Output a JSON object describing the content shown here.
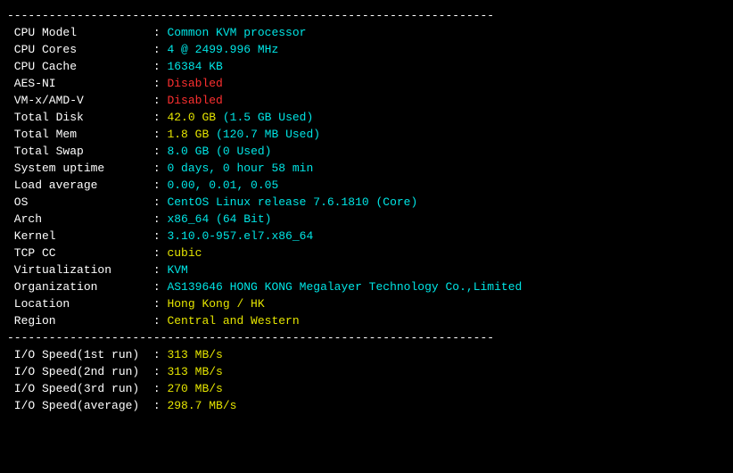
{
  "dividers": {
    "top": "----------------------------------------------------------------------",
    "mid": "----------------------------------------------------------------------"
  },
  "fields": [
    {
      "label": "CPU Model",
      "value": [
        {
          "t": "Common KVM processor",
          "c": "cyan"
        }
      ]
    },
    {
      "label": "CPU Cores",
      "value": [
        {
          "t": "4 @ 2499.996 MHz",
          "c": "cyan"
        }
      ]
    },
    {
      "label": "CPU Cache",
      "value": [
        {
          "t": "16384 KB",
          "c": "cyan"
        }
      ]
    },
    {
      "label": "AES-NI",
      "value": [
        {
          "t": "Disabled",
          "c": "red"
        }
      ]
    },
    {
      "label": "VM-x/AMD-V",
      "value": [
        {
          "t": "Disabled",
          "c": "red"
        }
      ]
    },
    {
      "label": "Total Disk",
      "value": [
        {
          "t": "42.0 GB",
          "c": "yellow"
        },
        {
          "t": " ",
          "c": "white"
        },
        {
          "t": "(1.5 GB Used)",
          "c": "cyan"
        }
      ]
    },
    {
      "label": "Total Mem",
      "value": [
        {
          "t": "1.8 GB",
          "c": "yellow"
        },
        {
          "t": " ",
          "c": "white"
        },
        {
          "t": "(120.7 MB Used)",
          "c": "cyan"
        }
      ]
    },
    {
      "label": "Total Swap",
      "value": [
        {
          "t": "8.0 GB",
          "c": "cyan"
        },
        {
          "t": " ",
          "c": "white"
        },
        {
          "t": "(0 Used)",
          "c": "cyan"
        }
      ]
    },
    {
      "label": "System uptime",
      "value": [
        {
          "t": "0 days, 0 hour 58 min",
          "c": "cyan"
        }
      ]
    },
    {
      "label": "Load average",
      "value": [
        {
          "t": "0.00, 0.01, 0.05",
          "c": "cyan"
        }
      ]
    },
    {
      "label": "OS",
      "value": [
        {
          "t": "CentOS Linux release 7.6.1810 (Core)",
          "c": "cyan"
        }
      ]
    },
    {
      "label": "Arch",
      "value": [
        {
          "t": "x86_64 (64 Bit)",
          "c": "cyan"
        }
      ]
    },
    {
      "label": "Kernel",
      "value": [
        {
          "t": "3.10.0-957.el7.x86_64",
          "c": "cyan"
        }
      ]
    },
    {
      "label": "TCP CC",
      "value": [
        {
          "t": "cubic",
          "c": "yellow"
        }
      ]
    },
    {
      "label": "Virtualization",
      "value": [
        {
          "t": "KVM",
          "c": "cyan"
        }
      ]
    },
    {
      "label": "Organization",
      "value": [
        {
          "t": "AS139646 HONG KONG Megalayer Technology Co.,Limited",
          "c": "cyan"
        }
      ]
    },
    {
      "label": "Location",
      "value": [
        {
          "t": "Hong Kong / HK",
          "c": "yellow"
        }
      ]
    },
    {
      "label": "Region",
      "value": [
        {
          "t": "Central and Western",
          "c": "yellow"
        }
      ]
    }
  ],
  "io": [
    {
      "label": "I/O Speed(1st run)",
      "value": [
        {
          "t": "313 MB/s",
          "c": "yellow"
        }
      ]
    },
    {
      "label": "I/O Speed(2nd run)",
      "value": [
        {
          "t": "313 MB/s",
          "c": "yellow"
        }
      ]
    },
    {
      "label": "I/O Speed(3rd run)",
      "value": [
        {
          "t": "270 MB/s",
          "c": "yellow"
        }
      ]
    },
    {
      "label": "I/O Speed(average)",
      "value": [
        {
          "t": "298.7 MB/s",
          "c": "yellow"
        }
      ]
    }
  ],
  "label_width": 20
}
